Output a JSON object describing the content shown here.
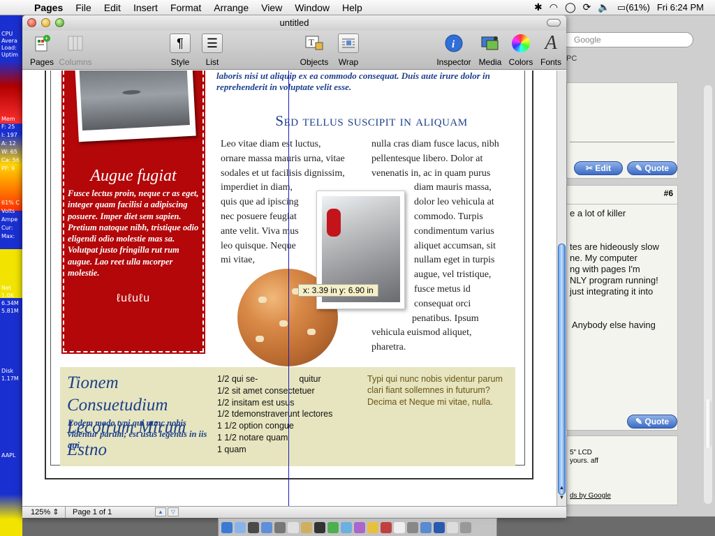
{
  "menubar": {
    "app_name": "Pages",
    "items": [
      "File",
      "Edit",
      "Insert",
      "Format",
      "Arrange",
      "View",
      "Window",
      "Help"
    ],
    "battery": "(61%)",
    "clock": "Fri 6:24 PM"
  },
  "monitor": {
    "labels": [
      "CPU",
      "Avera",
      "Load:",
      "Uptim",
      "Mem",
      "F: 25",
      "I: 197",
      "A: 12",
      "W: 65",
      "Ca: 56",
      "PF: 9",
      "61% C",
      "Volts",
      "Ampe",
      "Cur:",
      "Max:",
      "Net",
      "1.0K",
      "6.34M",
      "5.81M",
      "Disk",
      "1.17M",
      "AAPL",
      "3m"
    ]
  },
  "browser": {
    "search_placeholder": "Google",
    "tab_text": "PC",
    "edit_label": "Edit",
    "quote_label": "Quote",
    "post_number": "#6",
    "post_text": "e a lot of killer\n\n\ntes are hideously slow\nne. My computer\nng with pages I'm\nNLY program running!\njust integrating it into\n\n\n Anybody else having",
    "ad_text_1": "5\" LCD",
    "ad_text_2": "yours. aff",
    "ad_footer": "ds by Google"
  },
  "window": {
    "title": "untitled"
  },
  "toolbar": {
    "pages": "Pages",
    "columns": "Columns",
    "style": "Style",
    "list": "List",
    "objects": "Objects",
    "wrap": "Wrap",
    "inspector": "Inspector",
    "media": "Media",
    "colors": "Colors",
    "fonts": "Fonts"
  },
  "document": {
    "top_line": "laboris nisi ut aliquip ex ea commodo consequat. Duis aute irure dolor in reprehenderit in voluptate velit esse.",
    "red_title": "Augue fugiat",
    "red_body": "Fusce lectus proin, neque cr as eget, integer quam facilisi a adipiscing posuere. Imper diet sem sapien. Pretium natoque nibh, tristique odio eligendi odio molestie mas sa. Volutpat justo fringilla rut rum augue. Lao reet ulla mcorper molestie.",
    "red_ornament": "ℓuℓuℓu",
    "heading": "Sed tellus suscipit in aliquam",
    "col_left": [
      "Leo vitae diam est luctus,",
      "ornare massa mauris urna, vitae",
      "sodales et ut facilisis dignissim,",
      "imperdiet in diam,",
      "quis que ad ipiscing",
      "nec posuere feugiat",
      "ante velit. Viva mus",
      "leo quisque. Neque",
      "mi vitae,"
    ],
    "col_right_top": [
      "nulla cras diam fusce lacus, nibh",
      "pellentesque libero. Dolor at",
      "venenatis in, ac in quam purus"
    ],
    "col_right_indent": [
      "diam mauris massa,",
      "dolor leo vehicula at",
      "commodo. Turpis",
      "condimentum varius",
      "aliquet accumsan, sit",
      "nullam eget in turpis",
      "augue, vel tristique,",
      "fusce metus id",
      "consequat orci"
    ],
    "col_right_indent2": [
      "penatibus. Ipsum"
    ],
    "col_right_bottom": [
      "vehicula euismod aliquet,",
      "pharetra."
    ],
    "coord_label": "x: 3.39 in   y: 6.90 in",
    "yellow_title": "Tionem Consuetudium Lecotrum Mirum Estno",
    "yellow_sub": "Eodem modo typi qui nunc nobis videntur parum; est usus legentis in iis qui.",
    "recipe": [
      "1/2 qui se-                 quitur",
      "1/2 sit amet consectetuer",
      "1/2 insitam est usus",
      "1/2 tdemonstraverunt lectores",
      "1 1/2 option congue",
      "1 1/2 notare quam",
      "1 quam"
    ],
    "yellow_side": "Typi qui nunc nobis videntur parum clari fiant sollemnes in futurum? Decima et Neque mi vitae, nulla."
  },
  "status": {
    "zoom": "125%",
    "page_info": "Page 1 of 1"
  },
  "colors": {
    "accent_blue": "#1c3f8c",
    "red_box": "#b3070a",
    "yellow_box": "#e6e5bf"
  }
}
